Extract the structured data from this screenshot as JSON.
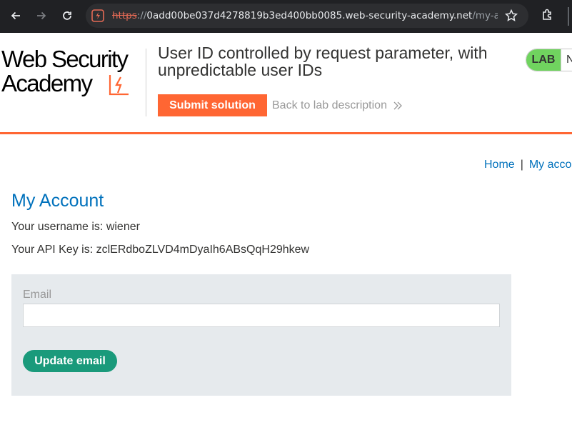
{
  "browser": {
    "url_scheme": "https",
    "url_sep": "://",
    "url_host": "0add00be037d4278819b3ed400bb0085.web-security-academy.net",
    "url_path": "/my-acc…",
    "icons": {
      "back": "back-arrow-icon",
      "forward": "forward-arrow-icon",
      "reload": "reload-icon",
      "site": "site-info-icon",
      "bookmark": "star-icon",
      "extensions": "puzzle-icon"
    }
  },
  "header": {
    "logo_line1": "Web Security",
    "logo_line2": "Academy",
    "lab_title": "User ID controlled by request parameter, with unpredictable user IDs",
    "submit_label": "Submit solution",
    "back_label": "Back to lab description",
    "badge_lab": "LAB",
    "badge_status": "N",
    "accent_color": "#ff6633",
    "badge_color": "#70d35f"
  },
  "nav": {
    "home": "Home",
    "separator": "|",
    "my_account": "My acco"
  },
  "main": {
    "title": "My Account",
    "username_line": "Your username is: wiener",
    "api_key_line": "Your API Key is: zclERdboZLVD4mDyaIh6ABsQqH29hkew",
    "email_label": "Email",
    "email_value": "",
    "update_label": "Update email",
    "link_color": "#0071bc",
    "button_color": "#1a9a7b"
  }
}
